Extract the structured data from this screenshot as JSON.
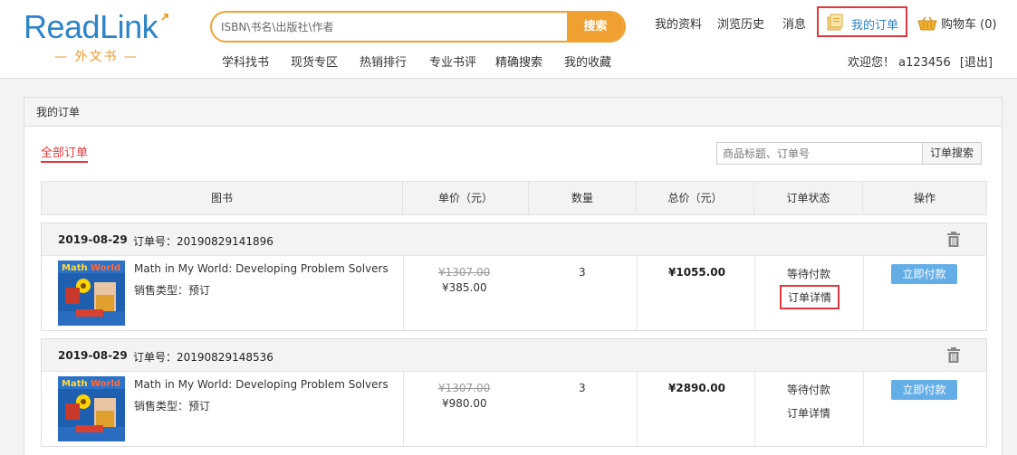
{
  "logo": {
    "main": "ReadLink",
    "sub": "— 外文书 —"
  },
  "search": {
    "placeholder": "ISBN\\书名\\出版社\\作者",
    "button": "搜索"
  },
  "subnav": [
    "学科找书",
    "现货专区",
    "热销排行",
    "专业书评",
    "精确搜索",
    "我的收藏"
  ],
  "topnav": {
    "profile": "我的资料",
    "history": "浏览历史",
    "messages": "消息",
    "my_orders": "我的订单",
    "cart": "购物车 (0)"
  },
  "user": {
    "welcome": "欢迎您！ a123456",
    "logout": "[退出]"
  },
  "panel": {
    "title": "我的订单",
    "tab_all": "全部订单",
    "order_search_placeholder": "商品标题、订单号",
    "order_search_button": "订单搜索"
  },
  "table": {
    "columns": [
      "图书",
      "单价（元）",
      "数量",
      "总价（元）",
      "订单状态",
      "操作"
    ]
  },
  "orders": [
    {
      "date": "2019-08-29",
      "order_no": "订单号：20190829141896",
      "title": "Math in My World: Developing Problem Solvers",
      "sale_type": "销售类型：预订",
      "original_price": "¥1307.00",
      "price": "¥385.00",
      "quantity": "3",
      "total": "¥1055.00",
      "status": "等待付款",
      "detail": "订单详情",
      "pay": "立即付款"
    },
    {
      "date": "2019-08-29",
      "order_no": "订单号：20190829148536",
      "title": "Math in My World: Developing Problem Solvers",
      "sale_type": "销售类型：预订",
      "original_price": "¥1307.00",
      "price": "¥980.00",
      "quantity": "3",
      "total": "¥2890.00",
      "status": "等待付款",
      "detail": "订单详情",
      "pay": "立即付款"
    }
  ],
  "colors": {
    "brand_blue": "#2d84c8",
    "brand_orange": "#f0a030",
    "highlight_red": "#e0383e",
    "pay_blue": "#64aee8"
  }
}
